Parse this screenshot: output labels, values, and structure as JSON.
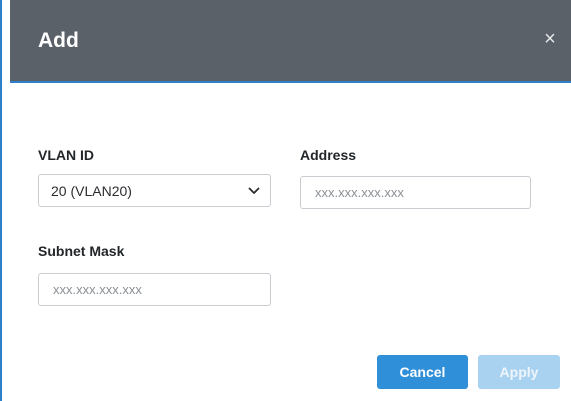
{
  "dialog": {
    "title": "Add",
    "close_symbol": "×"
  },
  "form": {
    "vlan": {
      "label": "VLAN ID",
      "selected": "20 (VLAN20)"
    },
    "address": {
      "label": "Address",
      "placeholder": "xxx.xxx.xxx.xxx"
    },
    "subnet": {
      "label": "Subnet Mask",
      "placeholder": "xxx.xxx.xxx.xxx"
    }
  },
  "buttons": {
    "cancel": "Cancel",
    "apply": "Apply",
    "apply_enabled": false
  },
  "colors": {
    "header_bg": "#5a6169",
    "accent_border": "#2f7fc9",
    "primary_button": "#2f8fd8",
    "disabled_button": "#a9d1f0"
  },
  "icons": {
    "close": "close-icon",
    "select_chevron": "chevron-down-icon"
  }
}
